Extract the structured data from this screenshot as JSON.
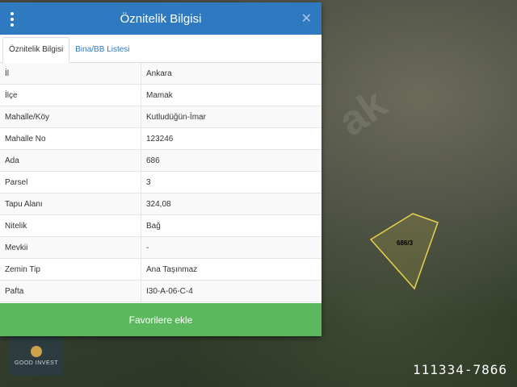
{
  "panel": {
    "title": "Öznitelik Bilgisi",
    "tabs": [
      {
        "label": "Öznitelik Bilgisi",
        "active": true
      },
      {
        "label": "Bina/BB Listesi",
        "active": false
      }
    ],
    "rows": [
      {
        "key": "İl",
        "value": "Ankara"
      },
      {
        "key": "İlçe",
        "value": "Mamak"
      },
      {
        "key": "Mahalle/Köy",
        "value": "Kutludüğün-İmar"
      },
      {
        "key": "Mahalle No",
        "value": "123246"
      },
      {
        "key": "Ada",
        "value": "686"
      },
      {
        "key": "Parsel",
        "value": "3"
      },
      {
        "key": "Tapu Alanı",
        "value": "324,08"
      },
      {
        "key": "Nitelik",
        "value": "Bağ"
      },
      {
        "key": "Mevkii",
        "value": "-"
      },
      {
        "key": "Zemin Tip",
        "value": "Ana Taşınmaz"
      },
      {
        "key": "Pafta",
        "value": "I30-A-06-C-4"
      }
    ],
    "favorite_label": "Favorilere ekle",
    "header_color": "#2f79c0",
    "button_color": "#5cb85c"
  },
  "map": {
    "parcel_label": "686/3",
    "watermark": "ak",
    "parcel_outline_color": "#e6d34a"
  },
  "logo": {
    "text": "GOOD INVEST"
  },
  "phone": "111334-7866"
}
